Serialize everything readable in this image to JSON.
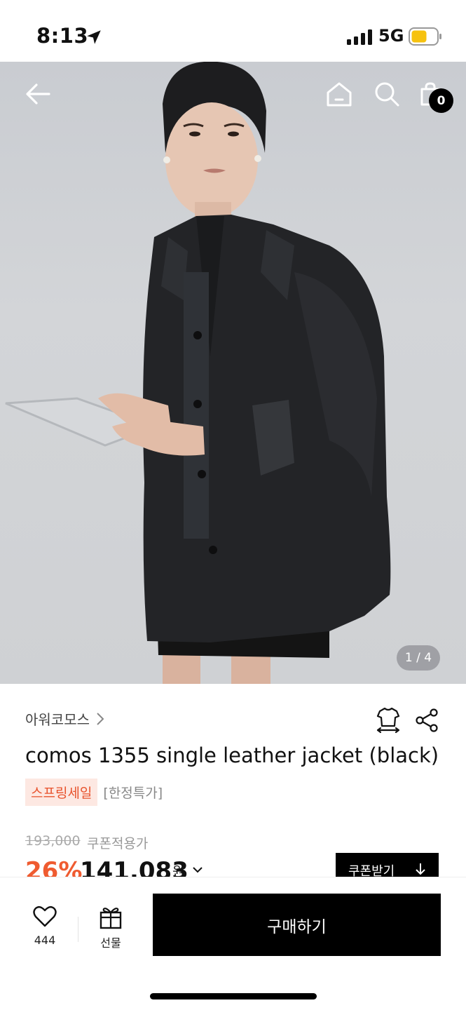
{
  "status_bar": {
    "time": "8:13",
    "network": "5G",
    "icons": [
      "location-arrow-icon",
      "signal-icon",
      "battery-icon"
    ],
    "battery_color": "#f6c20f"
  },
  "header": {
    "icons": [
      "back-arrow-icon",
      "home-icon",
      "search-icon",
      "cart-icon"
    ],
    "cart_count": "0"
  },
  "hero": {
    "page_indicator": "1 / 4"
  },
  "product": {
    "brand": "아워코모스",
    "title": "comos 1355 single leather jacket (black)",
    "sale_badge": "스프링세일",
    "limited_tag": "[한정특가]",
    "original_price": "193,000",
    "coupon_label": "쿠폰적용가",
    "discount": "26%",
    "sale_price": "141,083",
    "currency_unit": "원",
    "coupon_button": "쿠폰받기",
    "icons": [
      "size-guide-icon",
      "share-icon",
      "chevron-right-icon"
    ]
  },
  "bottom_bar": {
    "like_count": "444",
    "gift_label": "선물",
    "buy_label": "구매하기",
    "icons": [
      "heart-icon",
      "gift-icon"
    ]
  },
  "colors": {
    "accent": "#ef5b30",
    "sale_badge_bg": "#fde8e2",
    "primary_button": "#000000"
  }
}
